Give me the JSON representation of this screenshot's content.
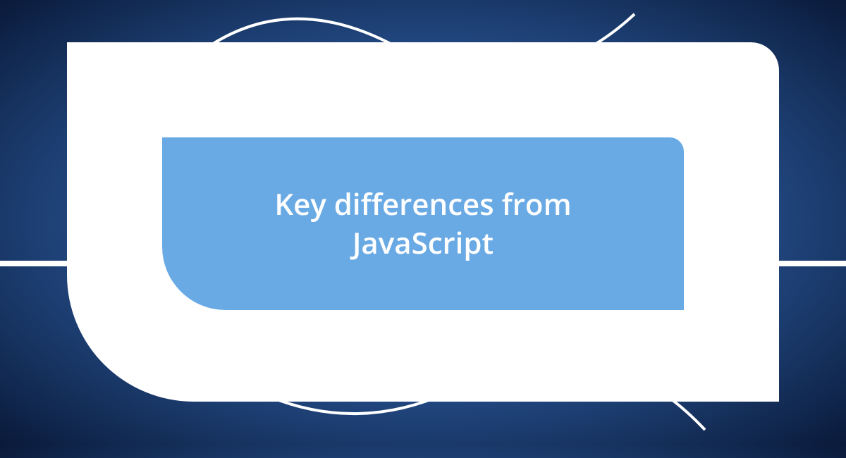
{
  "title": "Key differences from JavaScript"
}
